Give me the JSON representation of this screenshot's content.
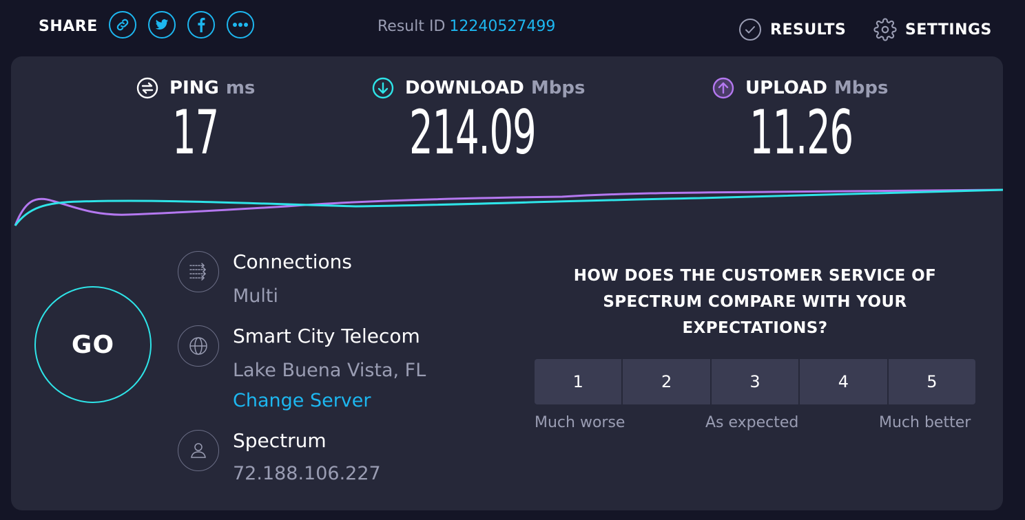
{
  "header": {
    "share_label": "SHARE",
    "share_buttons": [
      {
        "icon": "link-icon"
      },
      {
        "icon": "twitter-icon"
      },
      {
        "icon": "facebook-icon"
      },
      {
        "icon": "more-icon"
      }
    ],
    "result_id_label": "Result ID",
    "result_id_value": "12240527499",
    "results_label": "RESULTS",
    "settings_label": "SETTINGS"
  },
  "metrics": {
    "ping": {
      "label": "PING",
      "unit": "ms",
      "value": "17",
      "icon": "ping-icon"
    },
    "download": {
      "label": "DOWNLOAD",
      "unit": "Mbps",
      "value": "214.09",
      "icon": "download-arrow-icon"
    },
    "upload": {
      "label": "UPLOAD",
      "unit": "Mbps",
      "value": "11.26",
      "icon": "upload-arrow-icon"
    }
  },
  "go_button_label": "GO",
  "info": {
    "connections": {
      "title": "Connections",
      "value": "Multi",
      "icon": "connections-icon"
    },
    "server": {
      "title": "Smart City Telecom",
      "location": "Lake Buena Vista, FL",
      "change_label": "Change Server",
      "icon": "globe-icon"
    },
    "provider": {
      "title": "Spectrum",
      "ip": "72.188.106.227",
      "icon": "user-icon"
    }
  },
  "survey": {
    "question": "HOW DOES THE CUSTOMER SERVICE OF SPECTRUM COMPARE WITH YOUR EXPECTATIONS?",
    "options": [
      "1",
      "2",
      "3",
      "4",
      "5"
    ],
    "label_low": "Much worse",
    "label_mid": "As expected",
    "label_high": "Much better"
  },
  "colors": {
    "accent_blue": "#1db7f0",
    "download_cyan": "#2ee4e8",
    "upload_purple": "#b478f0",
    "background": "#141526",
    "card": "#262839"
  }
}
